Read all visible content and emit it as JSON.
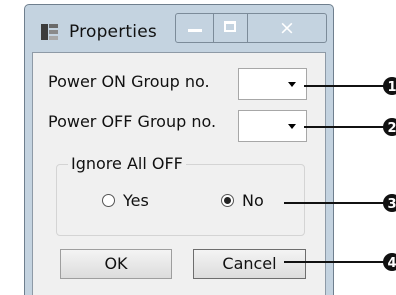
{
  "window": {
    "title": "Properties",
    "app_icon": "properties-app-icon",
    "caption_buttons": {
      "minimize_icon": "minimize-icon",
      "maximize_icon": "maximize-icon",
      "close_glyph": "×"
    }
  },
  "form": {
    "power_on_label": "Power ON Group no.",
    "power_on_value": "",
    "power_off_label": "Power OFF Group no.",
    "power_off_value": "",
    "ignore_group": {
      "legend": "Ignore All OFF",
      "options": [
        {
          "label": "Yes",
          "checked": false
        },
        {
          "label": "No",
          "checked": true
        }
      ]
    },
    "ok_label": "OK",
    "cancel_label": "Cancel"
  },
  "callouts": [
    "1",
    "2",
    "3",
    "4"
  ],
  "colors": {
    "title_bar": "#c4d3e0",
    "client_bg": "#f0f0f0",
    "callout": "#111111"
  }
}
